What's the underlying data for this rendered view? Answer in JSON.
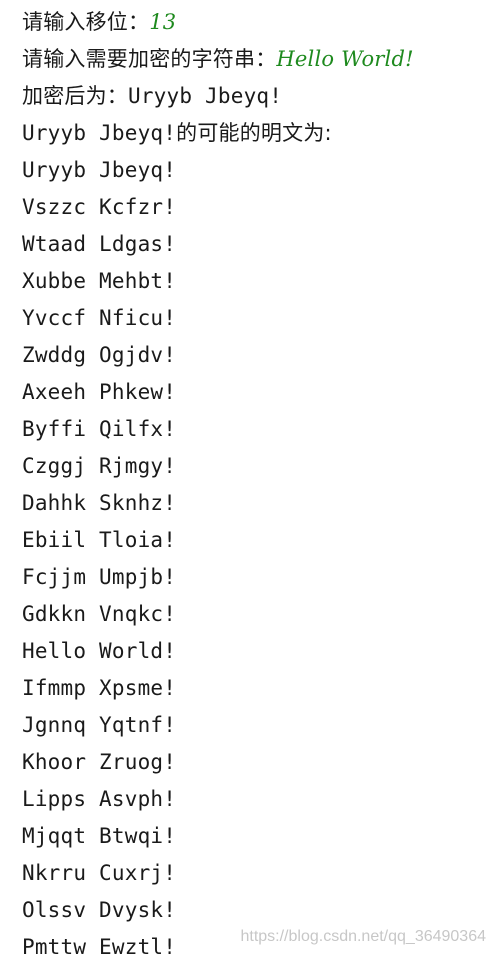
{
  "colors": {
    "text": "#1a1a1a",
    "input": "#1e8a1e",
    "watermark": "#b4b4b4"
  },
  "console": {
    "shift_prompt": "请输入移位：",
    "shift_value": "13",
    "text_prompt": "请输入需要加密的字符串：",
    "text_value": "Hello World!",
    "encrypted_label": "加密后为：",
    "encrypted_value": "Uryyb Jbeyq!",
    "candidates_header_text": "Uryyb Jbeyq!",
    "candidates_header_label": "的可能的明文为:",
    "candidates": [
      "Uryyb Jbeyq!",
      "Vszzc Kcfzr!",
      "Wtaad Ldgas!",
      "Xubbe Mehbt!",
      "Yvccf Nficu!",
      "Zwddg Ogjdv!",
      "Axeeh Phkew!",
      "Byffi Qilfx!",
      "Czggj Rjmgy!",
      "Dahhk Sknhz!",
      "Ebiil Tloia!",
      "Fcjjm Umpjb!",
      "Gdkkn Vnqkc!",
      "Hello World!",
      "Ifmmp Xpsme!",
      "Jgnnq Yqtnf!",
      "Khoor Zruog!",
      "Lipps Asvph!",
      "Mjqqt Btwqi!",
      "Nkrru Cuxrj!",
      "Olssv Dvysk!",
      "Pmttw Ewztl!"
    ]
  },
  "watermark": "https://blog.csdn.net/qq_36490364"
}
